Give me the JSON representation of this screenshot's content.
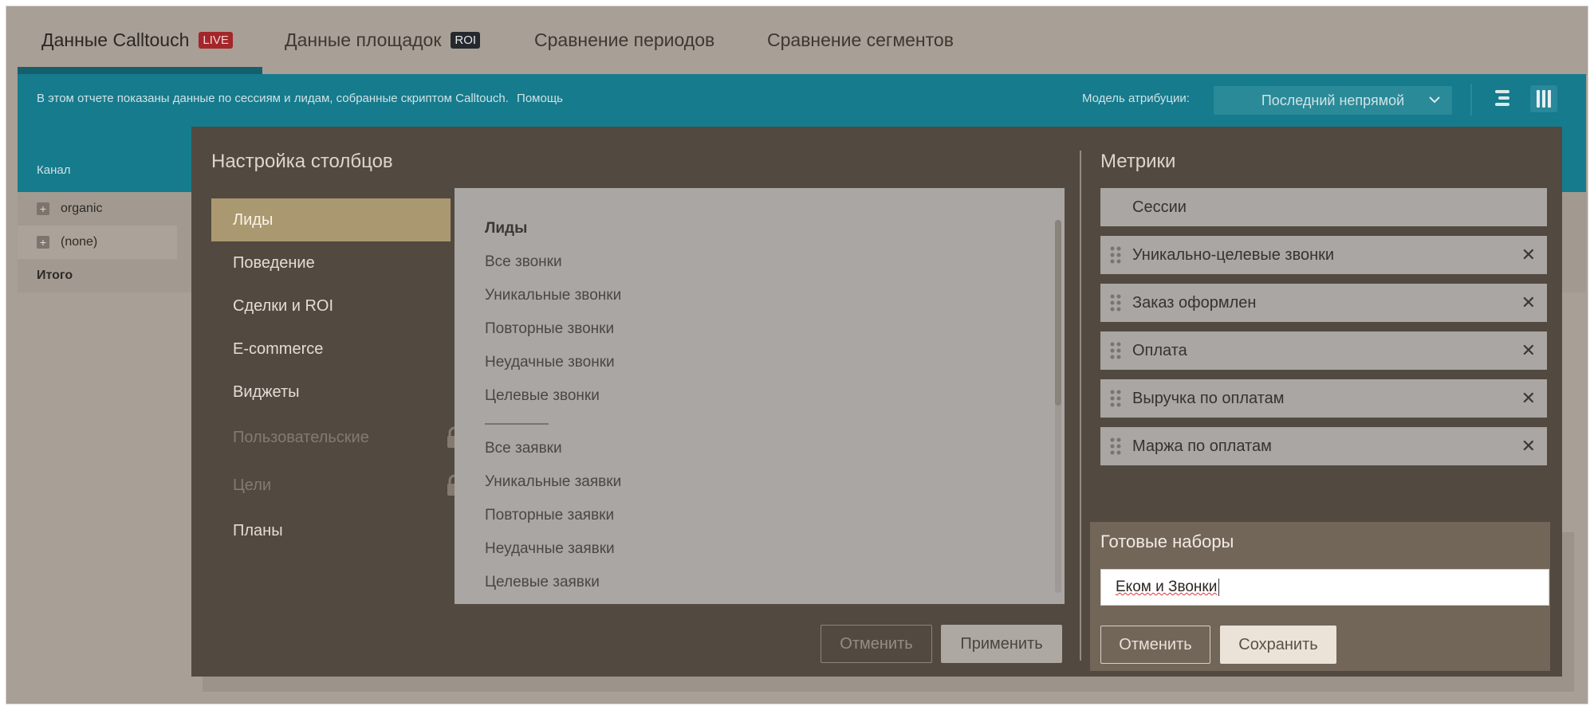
{
  "tabs": [
    {
      "label": "Данные Calltouch",
      "badge": "LIVE"
    },
    {
      "label": "Данные площадок",
      "badge": "ROI"
    },
    {
      "label": "Сравнение периодов"
    },
    {
      "label": "Сравнение сегментов"
    }
  ],
  "info_bar": {
    "text": "В этом отчете показаны данные по сессиям и лидам, собранные скриптом Calltouch.",
    "help_link": "Помощь",
    "attribution_label": "Модель атрибуции:",
    "attribution_value": "Последний непрямой"
  },
  "table": {
    "column_header": "Канал",
    "rows": [
      "organic",
      "(none)"
    ],
    "total_label": "Итого"
  },
  "modal": {
    "title": "Настройка столбцов",
    "categories": [
      {
        "label": "Лиды",
        "active": true
      },
      {
        "label": "Поведение"
      },
      {
        "label": "Сделки и ROI"
      },
      {
        "label": "E-commerce"
      },
      {
        "label": "Виджеты"
      },
      {
        "label": "Пользовательские",
        "locked": true
      },
      {
        "label": "Цели",
        "locked": true
      },
      {
        "label": "Планы"
      }
    ],
    "metrics_header": "Лиды",
    "metrics_group1": [
      "Все звонки",
      "Уникальные звонки",
      "Повторные звонки",
      "Неудачные звонки",
      "Целевые звонки"
    ],
    "metrics_group2": [
      "Все заявки",
      "Уникальные заявки",
      "Повторные заявки",
      "Неудачные заявки",
      "Целевые заявки"
    ],
    "cancel_label": "Отменить",
    "apply_label": "Применить"
  },
  "selected": {
    "title": "Метрики",
    "fixed": "Сессии",
    "items": [
      "Уникально-целевые звонки",
      "Заказ оформлен",
      "Оплата",
      "Выручка по оплатам",
      "Маржа по оплатам"
    ]
  },
  "presets": {
    "title": "Готовые наборы",
    "input_value": "Еком и Звонки",
    "cancel_label": "Отменить",
    "save_label": "Сохранить"
  },
  "colors": {
    "accent_teal": "#167b8c",
    "modal_bg": "#524941",
    "active_category": "#aa9970",
    "live_badge": "#a3262a"
  }
}
